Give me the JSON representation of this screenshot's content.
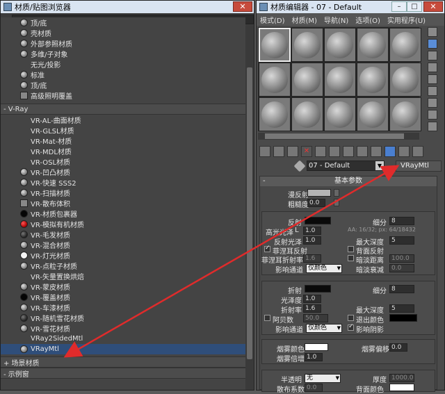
{
  "browser": {
    "title": "材质/贴图浏览器",
    "close": "✕",
    "std_items": [
      {
        "label": "顶/底",
        "swatch": "ball"
      },
      {
        "label": "壳材质",
        "swatch": "ball"
      },
      {
        "label": "外部参照材质",
        "swatch": "ball"
      },
      {
        "label": "多维/子对象",
        "swatch": "ball"
      },
      {
        "label": "无光/投影",
        "swatch": "none"
      },
      {
        "label": "标准",
        "swatch": "ball"
      },
      {
        "label": "顶/底",
        "swatch": "ball"
      },
      {
        "label": "高级照明覆盖",
        "swatch": "box"
      }
    ],
    "vray_group": "- V-Ray",
    "vray_items": [
      {
        "label": "VR-AL-曲面材质",
        "swatch": "none"
      },
      {
        "label": "VR-GLSL材质",
        "swatch": "none"
      },
      {
        "label": "VR-Mat-材质",
        "swatch": "none"
      },
      {
        "label": "VR-MDL材质",
        "swatch": "none"
      },
      {
        "label": "VR-OSL材质",
        "swatch": "none"
      },
      {
        "label": "VR-凹凸材质",
        "swatch": "ball"
      },
      {
        "label": "VR-快速 SSS2",
        "swatch": "ball"
      },
      {
        "label": "VR-扫描材质",
        "swatch": "ball"
      },
      {
        "label": "VR-散布体积",
        "swatch": "box"
      },
      {
        "label": "VR-材质包裹器",
        "swatch": "black"
      },
      {
        "label": "VR-模拟有机材质",
        "swatch": "red"
      },
      {
        "label": "VR-毛发材质",
        "swatch": "dark"
      },
      {
        "label": "VR-混合材质",
        "swatch": "ball"
      },
      {
        "label": "VR-灯光材质",
        "swatch": "white"
      },
      {
        "label": "VR-点粒子材质",
        "swatch": "ball"
      },
      {
        "label": "VR-矢量置换烘焙",
        "swatch": "none"
      },
      {
        "label": "VR-蒙皮材质",
        "swatch": "ball"
      },
      {
        "label": "VR-覆盖材质",
        "swatch": "black"
      },
      {
        "label": "VR-车漆材质",
        "swatch": "ball"
      },
      {
        "label": "VR-随机雪花材质",
        "swatch": "dark"
      },
      {
        "label": "VR-雪花材质",
        "swatch": "ball"
      },
      {
        "label": "VRay2SidedMtl",
        "swatch": "none"
      },
      {
        "label": "VRayMtl",
        "swatch": "ball"
      }
    ],
    "selected_index": 22,
    "scene_group": "+ 场景材质",
    "sample_group": "- 示例窗"
  },
  "editor": {
    "title": "材质编辑器 - 07 - Default",
    "close": "✕",
    "menu": [
      "模式(D)",
      "材质(M)",
      "导航(N)",
      "选项(O)",
      "实用程序(U)"
    ],
    "material_name": "07 - Default",
    "material_type": "VRayMtl",
    "rollout_title": "基本参数",
    "labels": {
      "diffuse": "漫反射",
      "roughness": "粗糙度",
      "reflect": "反射",
      "subdivs": "细分",
      "hilight_gloss": "高光光泽",
      "aa": "AA: 16/32; px: 64/18432",
      "refl_gloss": "反射光泽",
      "max_depth": "最大深度",
      "fresnel": "菲涅耳反射",
      "back_reflect": "背面反射",
      "fresnel_ior": "菲涅耳折射率",
      "dim_distance": "暗淡距离",
      "dim_falloff": "暗淡衰减",
      "affect_channels": "影响通道",
      "color_only": "仅颜色",
      "refract": "折射",
      "glossiness": "光泽度",
      "ior": "折射率",
      "abbe": "阿贝数",
      "exit_color": "退出颜色",
      "affect_shadows": "影响阴影",
      "fog_color": "烟雾颜色",
      "fog_bias": "烟雾偏移",
      "fog_mult": "烟雾倍增",
      "translucency": "半透明",
      "thickness": "厚度",
      "scatter": "散布系数",
      "back_color": "背面颜色",
      "none": "无",
      "L": "L"
    },
    "values": {
      "roughness": "0.0",
      "subdivs1": "8",
      "hilight": "1.0",
      "refl_gloss": "1.0",
      "max_depth1": "5",
      "fresnel_ior": "1.6",
      "dim_dist": "100.0",
      "dim_falloff": "0.0",
      "subdivs2": "8",
      "gloss2": "1.0",
      "ior": "1.6",
      "max_depth2": "5",
      "abbe": "50.0",
      "fog_bias": "0.0",
      "fog_mult": "1.0",
      "thickness": "1000.0",
      "scatter": "0.0"
    },
    "colors": {
      "diffuse": "#b4b4b4",
      "reflect": "#0a0a0a",
      "refract": "#0a0a0a",
      "exit": "#000000",
      "fog": "#ffffff",
      "back": "#ffffff"
    }
  },
  "arrow_color": "#e02b2b"
}
